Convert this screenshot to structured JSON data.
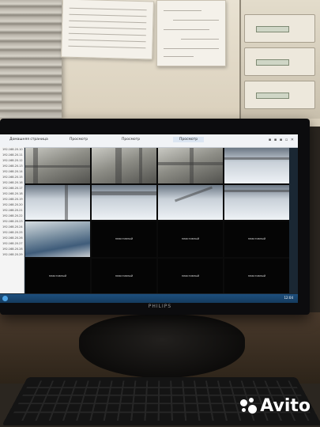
{
  "photo": {
    "monitor_brand": "PHILIPS",
    "watermark": "Avito"
  },
  "app": {
    "tabs": [
      {
        "label": "Домашняя страница"
      },
      {
        "label": "Просмотр"
      },
      {
        "label": "Просмотр"
      },
      {
        "label": "Просмотр"
      }
    ],
    "sidebar_items": [
      "192.168.20.10",
      "192.168.20.11",
      "192.168.20.12",
      "192.168.20.13",
      "192.168.20.14",
      "192.168.20.15",
      "192.168.20.16",
      "192.168.20.17",
      "192.168.20.18",
      "192.168.20.19",
      "192.168.20.20",
      "192.168.20.21",
      "192.168.20.22",
      "192.168.20.23",
      "192.168.20.24",
      "192.168.20.25",
      "192.168.20.26",
      "192.168.20.27",
      "192.168.20.28",
      "192.168.20.29"
    ],
    "empty_cell_text": "неактивный",
    "taskbar_clock": "12:04"
  }
}
